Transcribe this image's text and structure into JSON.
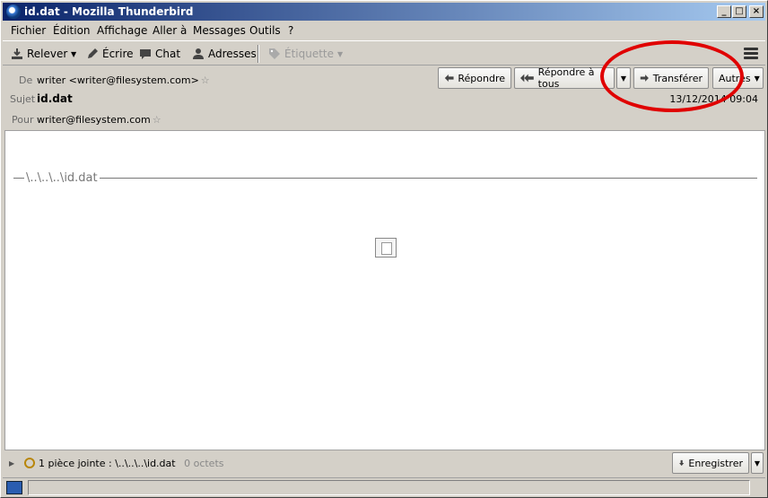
{
  "window": {
    "title": "id.dat - Mozilla Thunderbird"
  },
  "menu": [
    "Fichier",
    "Édition",
    "Affichage",
    "Aller à",
    "Messages",
    "Outils",
    "?"
  ],
  "toolbar": {
    "get_mail": "Relever",
    "write": "Écrire",
    "chat": "Chat",
    "addresses": "Adresses",
    "tag": "Étiquette"
  },
  "header": {
    "from_label": "De",
    "from_value": "writer <writer@filesystem.com>",
    "subject_label": "Sujet",
    "subject_value": "id.dat",
    "to_label": "Pour",
    "to_value": "writer@filesystem.com",
    "date": "13/12/2014 09:04",
    "buttons": {
      "reply": "Répondre",
      "reply_all": "Répondre à tous",
      "forward": "Transférer",
      "other": "Autres"
    }
  },
  "body": {
    "attachment_name": "\\..\\..\\..\\id.dat"
  },
  "attachments": {
    "summary": "1 pièce jointe :",
    "filename": "\\..\\..\\..\\id.dat",
    "size": "0 octets",
    "save": "Enregistrer"
  },
  "annotation_color": "#e00000"
}
